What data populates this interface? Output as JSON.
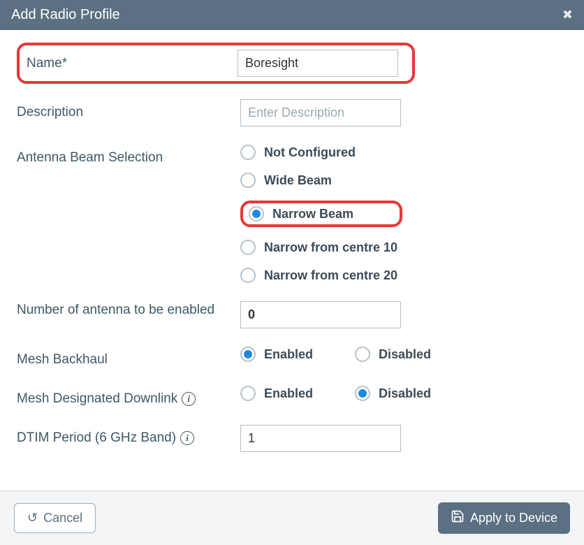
{
  "header": {
    "title": "Add Radio Profile"
  },
  "fields": {
    "name": {
      "label": "Name*",
      "value": "Boresight"
    },
    "description": {
      "label": "Description",
      "placeholder": "Enter Description",
      "value": ""
    },
    "antennaBeam": {
      "label": "Antenna Beam Selection",
      "options": {
        "not_configured": "Not Configured",
        "wide_beam": "Wide Beam",
        "narrow_beam": "Narrow Beam",
        "narrow_10": "Narrow from centre 10",
        "narrow_20": "Narrow from centre 20"
      },
      "selected": "narrow_beam"
    },
    "antennaCount": {
      "label": "Number of antenna to be enabled",
      "value": "0"
    },
    "meshBackhaul": {
      "label": "Mesh Backhaul",
      "enabled": "Enabled",
      "disabled": "Disabled",
      "selected": "enabled"
    },
    "meshDownlink": {
      "label": "Mesh Designated Downlink",
      "enabled": "Enabled",
      "disabled": "Disabled",
      "selected": "disabled"
    },
    "dtim": {
      "label": "DTIM Period (6 GHz Band)",
      "value": "1"
    }
  },
  "footer": {
    "cancel": "Cancel",
    "apply": "Apply to Device"
  }
}
